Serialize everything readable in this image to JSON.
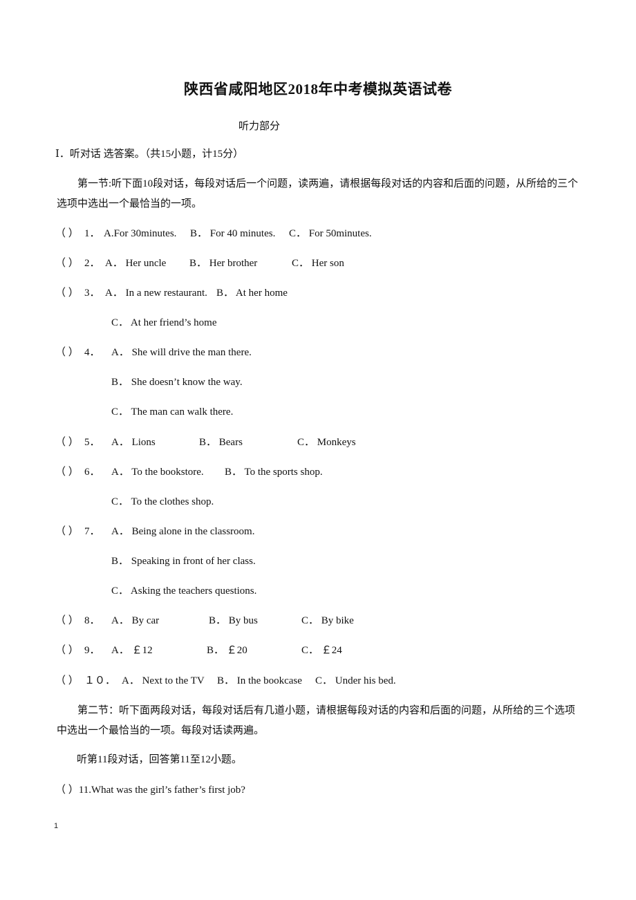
{
  "document": {
    "title": "陕西省咸阳地区2018年中考模拟英语试卷",
    "subtitle": "听力部分",
    "section_heading": "Ⅰ．听对话  选答案。（共15小题，计15分）",
    "part1_instructions": "第一节:听下面10段对话，每段对话后一个问题，读两遍，请根据每段对话的内容和后面的问题，从所给的三个选项中选出一个最恰当的一项。",
    "questions": [
      {
        "blank": "（    ）",
        "number": "1．",
        "options": {
          "A": "A.For 30minutes.",
          "B": "B．  For 40 minutes.",
          "C": "C．  For 50minutes."
        }
      },
      {
        "blank": "（    ）",
        "number": "2．",
        "options": {
          "A": "A．  Her uncle",
          "B": "B．  Her brother",
          "C": "C．  Her son"
        }
      },
      {
        "blank": "（    ）",
        "number": "3．",
        "options": {
          "A": "A．  In a new restaurant.",
          "B": "B．  At her home",
          "C": "C．  At her friend’s home"
        }
      },
      {
        "blank": "（    ）",
        "number": "4．",
        "options": {
          "A": "A．  She will drive the man there.",
          "B": "B．  She doesn’t know the way.",
          "C": "C．  The man can walk there."
        }
      },
      {
        "blank": "（    ）",
        "number": "5．",
        "options": {
          "A": "A．  Lions",
          "B": "B．  Bears",
          "C": "C．  Monkeys"
        }
      },
      {
        "blank": "（    ）",
        "number": "6．",
        "options": {
          "A": "A．  To the bookstore.",
          "B": "B．  To the sports shop.",
          "C": "C．  To the clothes shop."
        }
      },
      {
        "blank": "（    ）",
        "number": "7．",
        "options": {
          "A": "A．  Being alone in the classroom.",
          "B": "B．  Speaking in front of her class.",
          "C": "C．  Asking the teachers questions."
        }
      },
      {
        "blank": "（    ）",
        "number": "8．",
        "options": {
          "A": "A．  By car",
          "B": "B．  By bus",
          "C": "C．  By bike"
        }
      },
      {
        "blank": "（    ）",
        "number": "9．",
        "options": {
          "A": "A．  ￡12",
          "B": "B．  ￡20",
          "C": "C．  ￡24"
        }
      },
      {
        "blank": "（    ）",
        "number": "１０．",
        "options": {
          "A": "A．  Next to the TV",
          "B": "B．  In the bookcase",
          "C": "C．  Under his bed."
        }
      }
    ],
    "part2_instructions": "第二节：听下面两段对话，每段对话后有几道小题，请根据每段对话的内容和后面的问题，从所给的三个选项中选出一个最恰当的一项。每段对话读两遍。",
    "dialogue11_instruction": "听第11段对话，回答第11至12小题。",
    "question11": "（  ）11.What was the girl’s father’s first job?",
    "page_number": "1"
  }
}
